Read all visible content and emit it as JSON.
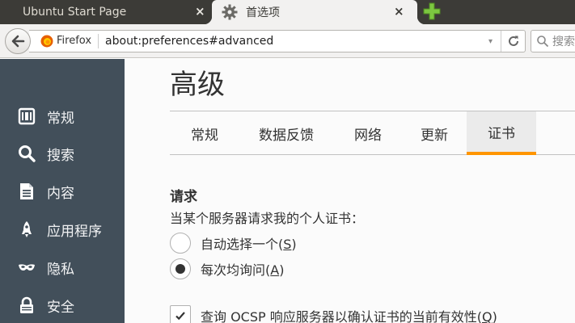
{
  "tabs": {
    "inactive": {
      "title": "Ubuntu Start Page",
      "close_icon": "×"
    },
    "active": {
      "title": "首选项",
      "icon": "gear-icon",
      "close_icon": "×"
    },
    "new_tab_icon": "plus-icon"
  },
  "navbar": {
    "identity_label": "Firefox",
    "url": "about:preferences#advanced",
    "search_placeholder": "搜索"
  },
  "sidebar": {
    "items": [
      {
        "label": "常规",
        "icon": "general-icon"
      },
      {
        "label": "搜索",
        "icon": "search-icon"
      },
      {
        "label": "内容",
        "icon": "content-icon"
      },
      {
        "label": "应用程序",
        "icon": "rocket-icon"
      },
      {
        "label": "隐私",
        "icon": "mask-icon"
      },
      {
        "label": "安全",
        "icon": "lock-icon"
      }
    ]
  },
  "main": {
    "heading": "高级",
    "tabs": [
      {
        "label": "常规"
      },
      {
        "label": "数据反馈"
      },
      {
        "label": "网络"
      },
      {
        "label": "更新"
      },
      {
        "label": "证书",
        "selected": true
      }
    ],
    "section_title": "请求",
    "section_desc": "当某个服务器请求我的个人证书：",
    "radio_auto": {
      "text": "自动选择一个(",
      "key": "S",
      "end": ")",
      "checked": false
    },
    "radio_ask": {
      "text": "每次均询问(",
      "key": "A",
      "end": ")",
      "checked": true
    },
    "ocsp": {
      "text": "查询 OCSP 响应服务器以确认证书的当前有效性(",
      "key": "Q",
      "end": ")",
      "checked": true
    }
  },
  "colors": {
    "sidebar_bg": "#424f5a",
    "accent": "#ff9500",
    "tabbar_bg": "#3c3b37"
  }
}
